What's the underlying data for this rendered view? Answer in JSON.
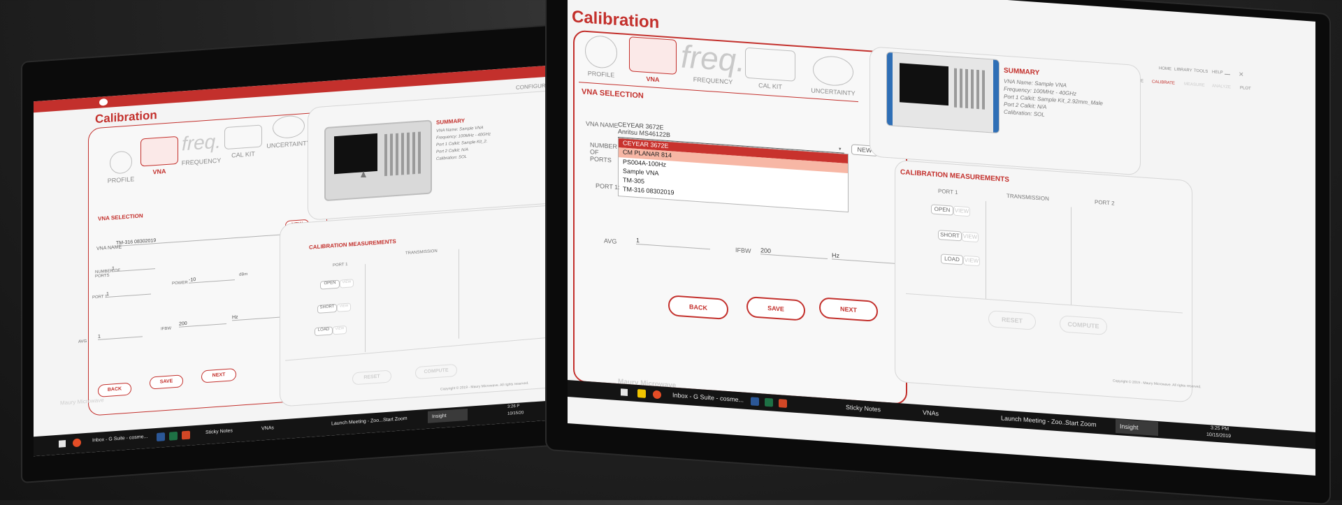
{
  "app": {
    "title": "Calibration",
    "brand_color": "#c3302c",
    "footer_brand": "Maury Microwave",
    "copyright": "Copyright © 2019 - Maury Microwave. All rights reserved."
  },
  "top_menu": [
    "HOME",
    "LIBRARY",
    "TOOLS",
    "HELP"
  ],
  "top_icons": [
    "CONFIGURE",
    "CALIBRATE",
    "MEASURE",
    "ANALYZE",
    "PLOT"
  ],
  "steps": [
    "PROFILE",
    "VNA",
    "FREQUENCY",
    "CAL KIT",
    "UNCERTAINTY"
  ],
  "freq_logo": "freq.",
  "vna_section": {
    "heading": "VNA SELECTION",
    "vna_name_label": "VNA NAME",
    "vna_name_value": "CEYEAR 3672E",
    "dropdown_value": "Anritsu MS46122B",
    "options": [
      "CEYEAR 3672E",
      "CM PLANAR 814",
      "PS004A-100Hz",
      "Sample VNA",
      "TM-305",
      "TM-316 08302019"
    ],
    "new_label": "NEW",
    "ports_label": "NUMBER OF PORTS",
    "port1_label": "PORT 1:",
    "avg_label": "AVG",
    "avg_value": "1",
    "ifbw_label": "IFBW",
    "ifbw_value": "200",
    "ifbw_unit": "Hz",
    "power_label": "POWER",
    "power_value": "-10",
    "power_unit": "dBm"
  },
  "left_screen_values": {
    "vna_name_value": "TM-316 08302019",
    "ports_value": "1",
    "port1_value": "1"
  },
  "nav_buttons": {
    "back": "BACK",
    "save": "SAVE",
    "next": "NEXT"
  },
  "summary": {
    "heading": "SUMMARY",
    "left_lines": [
      "VNA Name: Sample VNA",
      "Frequency: 100MHz - 40GHz",
      "Port 1 Calkit: Sample Kit_2.",
      "Port 2 Calkit: N/A",
      "Calibration: SOL"
    ],
    "right_lines": [
      "VNA Name: Sample VNA",
      "Frequency: 100MHz - 40GHz",
      "Port 1 Calkit: Sample Kit_2.92mm_Male",
      "Port 2 Calkit: N/A",
      "Calibration: SOL"
    ]
  },
  "cal_measurements": {
    "heading": "CALIBRATION MEASUREMENTS",
    "columns": [
      "PORT 1",
      "TRANSMISSION",
      "PORT 2"
    ],
    "standards": [
      "OPEN",
      "SHORT",
      "LOAD"
    ],
    "view_label": "VIEW",
    "reset_label": "RESET",
    "compute_label": "COMPUTE"
  },
  "taskbar": {
    "left_items": [
      "Inbox - G Suite - cosme...",
      "Sticky Notes",
      "VNAs",
      "Launch Meeting - Zoo...",
      "Start Zoom",
      "Insight"
    ],
    "right_items": [
      "Inbox - G Suite - cosme...",
      "Sticky Notes",
      "VNAs",
      "Launch Meeting - Zoo...",
      "Start Zoom",
      "Insight"
    ],
    "left_time": "3:26 P",
    "left_date": "10/15/20",
    "right_time": "3:25 PM",
    "right_date": "10/15/2019"
  }
}
